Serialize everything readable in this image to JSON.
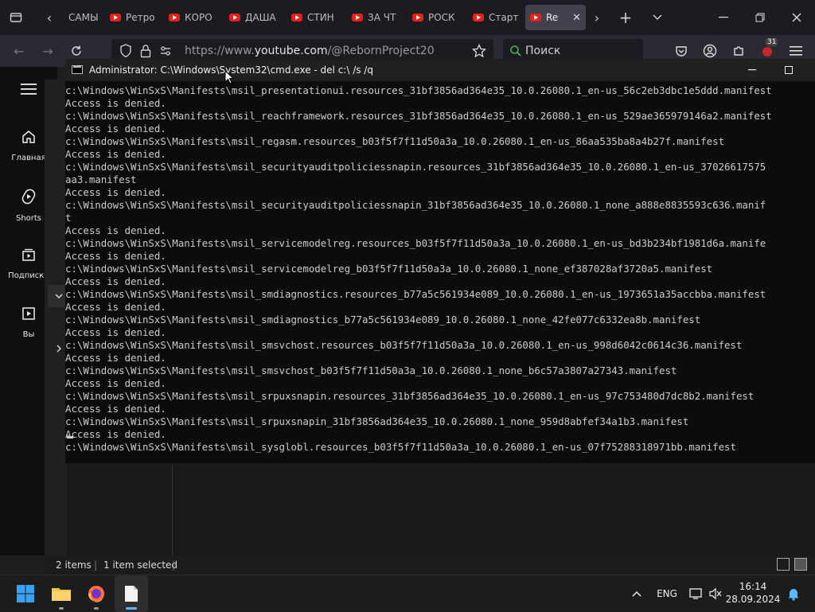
{
  "browser": {
    "tabs": [
      {
        "label": "САМЫ"
      },
      {
        "label": "Ретро"
      },
      {
        "label": "КОРО"
      },
      {
        "label": "ДАША"
      },
      {
        "label": "СТИН"
      },
      {
        "label": "ЗА ЧТ"
      },
      {
        "label": "РОСК"
      },
      {
        "label": "Старт"
      },
      {
        "label": "Re",
        "active": true
      }
    ],
    "url_prefix": "https://www.",
    "url_host": "youtube.com",
    "url_path": "/@RebornProject20",
    "search_placeholder": "Поиск",
    "badge_count": "31"
  },
  "youtube_sidebar": {
    "items": [
      {
        "label": "Главная",
        "icon": "home-icon"
      },
      {
        "label": "Shorts",
        "icon": "shorts-icon"
      },
      {
        "label": "Подписки",
        "icon": "subscriptions-icon"
      },
      {
        "label": "Вы",
        "icon": "you-icon"
      }
    ]
  },
  "cmd": {
    "title": "Administrator: C:\\Windows\\System32\\cmd.exe - del  c:\\ /s /q",
    "lines": [
      "c:\\Windows\\WinSxS\\Manifests\\msil_presentationui.resources_31bf3856ad364e35_10.0.26080.1_en-us_56c2eb3dbc1e5ddd.manifest",
      "Access is denied.",
      "c:\\Windows\\WinSxS\\Manifests\\msil_reachframework.resources_31bf3856ad364e35_10.0.26080.1_en-us_529ae365979146a2.manifest",
      "Access is denied.",
      "c:\\Windows\\WinSxS\\Manifests\\msil_regasm.resources_b03f5f7f11d50a3a_10.0.26080.1_en-us_86aa535ba8a4b27f.manifest",
      "Access is denied.",
      "c:\\Windows\\WinSxS\\Manifests\\msil_securityauditpoliciessnapin.resources_31bf3856ad364e35_10.0.26080.1_en-us_37026617575",
      "aa3.manifest",
      "Access is denied.",
      "c:\\Windows\\WinSxS\\Manifests\\msil_securityauditpoliciessnapin_31bf3856ad364e35_10.0.26080.1_none_a888e8835593c636.manif",
      "t",
      "Access is denied.",
      "c:\\Windows\\WinSxS\\Manifests\\msil_servicemodelreg.resources_b03f5f7f11d50a3a_10.0.26080.1_en-us_bd3b234bf1981d6a.manife",
      "Access is denied.",
      "c:\\Windows\\WinSxS\\Manifests\\msil_servicemodelreg_b03f5f7f11d50a3a_10.0.26080.1_none_ef387028af3720a5.manifest",
      "Access is denied.",
      "c:\\Windows\\WinSxS\\Manifests\\msil_smdiagnostics.resources_b77a5c561934e089_10.0.26080.1_en-us_1973651a35accbba.manifest",
      "Access is denied.",
      "c:\\Windows\\WinSxS\\Manifests\\msil_smdiagnostics_b77a5c561934e089_10.0.26080.1_none_42fe077c6332ea8b.manifest",
      "Access is denied.",
      "c:\\Windows\\WinSxS\\Manifests\\msil_smsvchost.resources_b03f5f7f11d50a3a_10.0.26080.1_en-us_998d6042c0614c36.manifest",
      "Access is denied.",
      "c:\\Windows\\WinSxS\\Manifests\\msil_smsvchost_b03f5f7f11d50a3a_10.0.26080.1_none_b6c57a3807a27343.manifest",
      "Access is denied.",
      "c:\\Windows\\WinSxS\\Manifests\\msil_srpuxsnapin.resources_31bf3856ad364e35_10.0.26080.1_en-us_97c753480d7dc8b2.manifest",
      "Access is denied.",
      "c:\\Windows\\WinSxS\\Manifests\\msil_srpuxsnapin_31bf3856ad364e35_10.0.26080.1_none_959d8abfef34a1b3.manifest",
      "Access is denied.",
      "c:\\Windows\\WinSxS\\Manifests\\msil_sysglobl.resources_b03f5f7f11d50a3a_10.0.26080.1_en-us_07f75288318971bb.manifest"
    ]
  },
  "explorer_status": {
    "items_count": "2 items",
    "selected": "1 item selected"
  },
  "taskbar": {
    "language": "ENG",
    "time": "16:14",
    "date": "28.09.2024"
  },
  "colors": {
    "youtube_red": "#e62117",
    "console_bg": "#0c0c0c",
    "console_fg": "#cccccc"
  }
}
